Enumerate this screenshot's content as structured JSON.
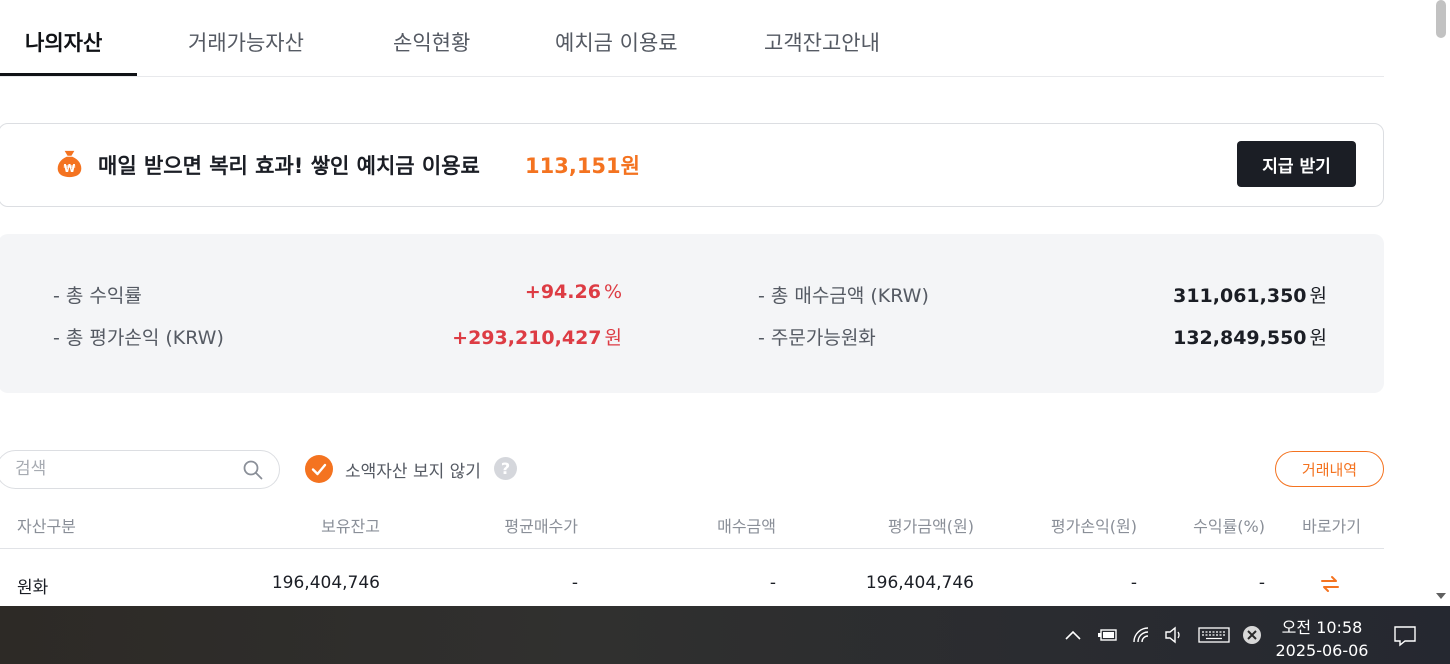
{
  "tabs": [
    {
      "label": "나의자산",
      "active": true
    },
    {
      "label": "거래가능자산",
      "active": false
    },
    {
      "label": "손익현황",
      "active": false
    },
    {
      "label": "예치금 이용료",
      "active": false
    },
    {
      "label": "고객잔고안내",
      "active": false
    }
  ],
  "banner": {
    "text": "매일 받으면 복리 효과! 쌓인 예치금 이용료",
    "amount": "113,151원",
    "button_label": "지급 받기",
    "icon": "won-pouch-icon"
  },
  "summary": {
    "total_return_label": "- 총 수익률",
    "total_return_value": "+94.26",
    "total_return_unit": "%",
    "total_pnl_label": "- 총 평가손익 (KRW)",
    "total_pnl_value": "+293,210,427",
    "total_pnl_unit": "원",
    "total_buy_label": "- 총 매수금액 (KRW)",
    "total_buy_value": "311,061,350",
    "total_buy_unit": "원",
    "orderable_label": "- 주문가능원화",
    "orderable_value": "132,849,550",
    "orderable_unit": "원"
  },
  "filter": {
    "search_placeholder": "검색",
    "hide_small_label": "소액자산 보지 않기",
    "hide_small_checked": true,
    "help_glyph": "?",
    "history_button": "거래내역"
  },
  "table": {
    "headers": [
      "자산구분",
      "보유잔고",
      "평균매수가",
      "매수금액",
      "평가금액(원)",
      "평가손익(원)",
      "수익률(%)",
      "바로가기"
    ],
    "rows": [
      {
        "asset": "원화",
        "balance": "196,404,746",
        "avg_price": "-",
        "buy_amount": "-",
        "eval_amount": "196,404,746",
        "eval_pnl": "-",
        "return_rate": "-",
        "shortcut_icon": "swap-arrows-icon"
      }
    ]
  },
  "taskbar": {
    "time": "오전 10:58",
    "date": "2025-06-06"
  },
  "colors": {
    "accent": "#f47320",
    "positive": "#dd3c44",
    "dark": "#1b1e25"
  }
}
